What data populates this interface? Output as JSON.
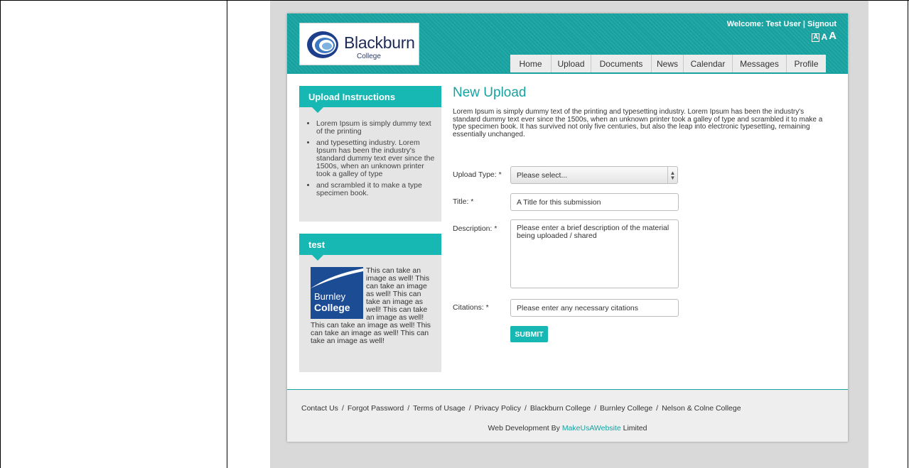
{
  "header": {
    "logo_name": "Blackburn",
    "logo_sub": "College",
    "welcome": "Welcome: Test User | Signout",
    "font_sizes": [
      "A",
      "A",
      "A"
    ]
  },
  "nav": {
    "items": [
      {
        "label": "Home"
      },
      {
        "label": "Upload"
      },
      {
        "label": "Documents"
      },
      {
        "label": "News"
      },
      {
        "label": "Calendar"
      },
      {
        "label": "Messages"
      },
      {
        "label": "Profile"
      }
    ]
  },
  "sidebar": {
    "instructions": {
      "title": "Upload Instructions",
      "items": [
        "Lorem Ipsum is simply dummy text of the printing",
        "and typesetting industry. Lorem Ipsum has been the industry's standard dummy text ever since the 1500s, when an unknown printer took a galley of type",
        "and scrambled it to make a type specimen book."
      ]
    },
    "test": {
      "title": "test",
      "image_text_1": "Burnley",
      "image_text_2": "College",
      "body": "This can take an image as well! This can take an image as well! This can take an image as well! This can take an image as well! This can take an image as well! This can take an image as well! This can take an image as well!"
    }
  },
  "main": {
    "title": "New Upload",
    "intro": "Lorem Ipsum is simply dummy text of the printing and typesetting industry. Lorem Ipsum has been the industry's standard dummy text ever since the 1500s, when an unknown printer took a galley of type and scrambled it to make a type specimen book. It has survived not only five centuries, but also the leap into electronic typesetting, remaining essentially unchanged.",
    "form": {
      "upload_type_label": "Upload Type: *",
      "upload_type_value": "Please select...",
      "title_label": "Title: *",
      "title_placeholder": "A Title for this submission",
      "description_label": "Description: *",
      "description_placeholder": "Please enter a brief description of the material being uploaded / shared",
      "citations_label": "Citations: *",
      "citations_placeholder": "Please enter any necessary citations",
      "submit_label": "SUBMIT"
    }
  },
  "footer": {
    "links": [
      "Contact Us",
      "/",
      "Forgot Password",
      "/",
      "Terms of Usage",
      "/",
      "Privacy Policy",
      "/",
      "Blackburn College",
      "/",
      "Burnley College",
      "/",
      "Nelson & Colne College"
    ],
    "credit_prefix": "Web Development By ",
    "credit_link": "MakeUsAWebsite",
    "credit_suffix": " Limited"
  },
  "colors": {
    "accent": "#17a2a0",
    "accent_light": "#17b8b3",
    "panel": "#e5e5e5"
  }
}
